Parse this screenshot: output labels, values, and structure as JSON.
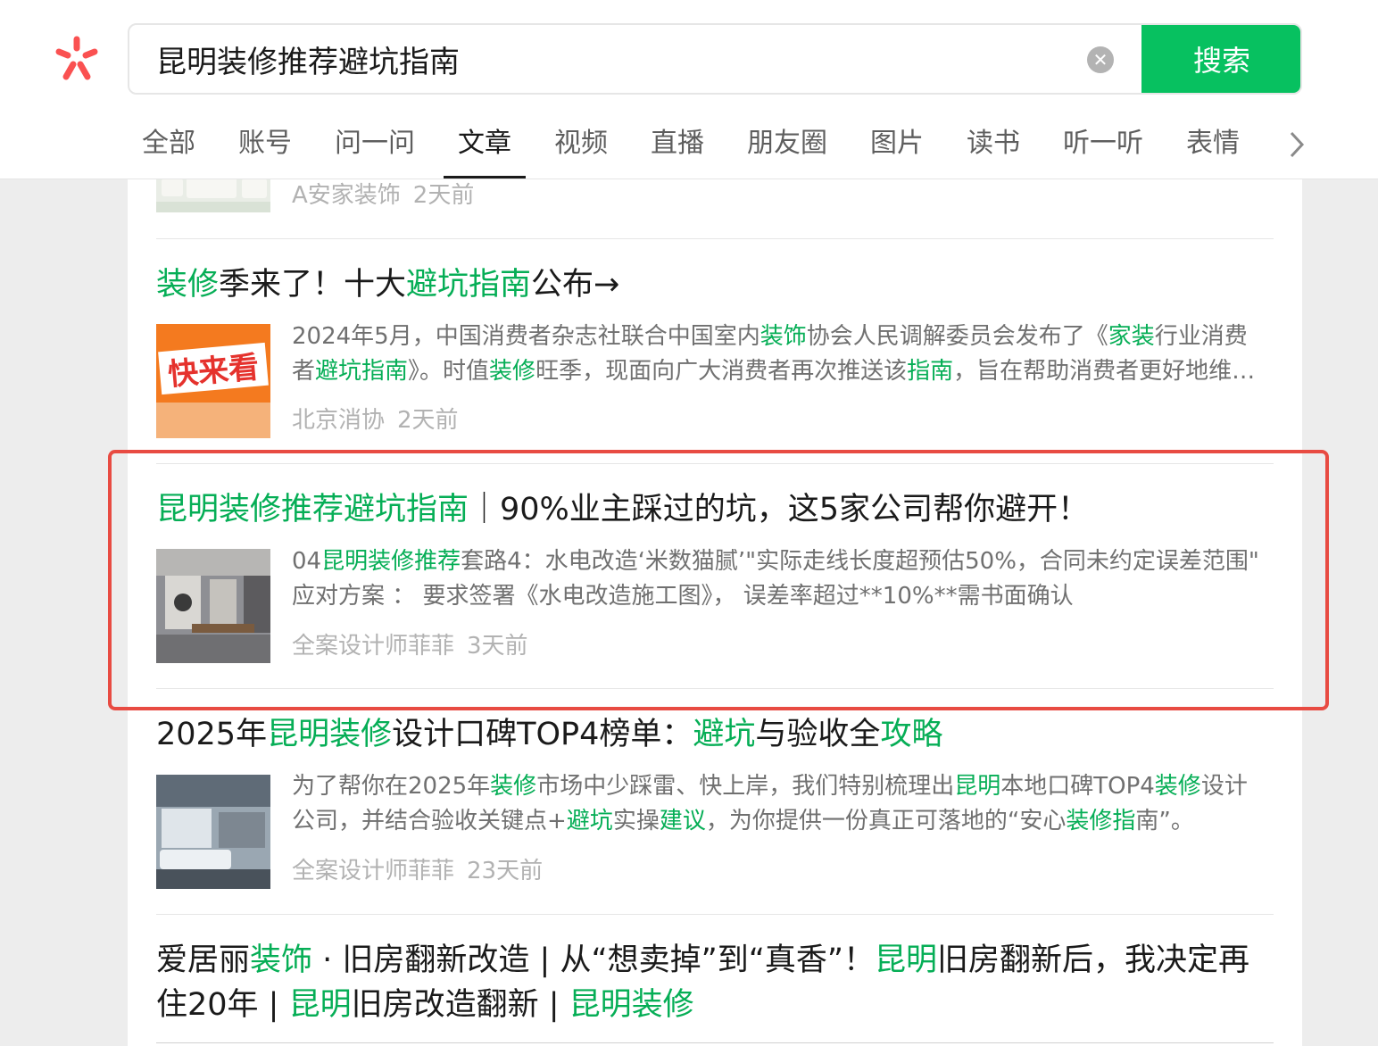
{
  "search": {
    "query": "昆明装修推荐避坑指南",
    "clear_icon": "close-circle-icon",
    "button_label": "搜索"
  },
  "tabs": [
    {
      "label": "全部",
      "active": false
    },
    {
      "label": "账号",
      "active": false
    },
    {
      "label": "问一问",
      "active": false
    },
    {
      "label": "文章",
      "active": true
    },
    {
      "label": "视频",
      "active": false
    },
    {
      "label": "直播",
      "active": false
    },
    {
      "label": "朋友圈",
      "active": false
    },
    {
      "label": "图片",
      "active": false
    },
    {
      "label": "读书",
      "active": false
    },
    {
      "label": "听一听",
      "active": false
    },
    {
      "label": "表情",
      "active": false
    }
  ],
  "results": [
    {
      "source": "A安家装饰",
      "time": "2天前"
    },
    {
      "title": [
        [
          "装修",
          true
        ],
        [
          "季来了！十大",
          false
        ],
        [
          "避坑指南",
          true
        ],
        [
          "公布→",
          false
        ]
      ],
      "desc": [
        [
          "2024年5月，中国消费者杂志社联合中国室内",
          false
        ],
        [
          "装饰",
          true
        ],
        [
          "协会人民调解委员会发布了《",
          false
        ],
        [
          "家装",
          true
        ],
        [
          "行业消费者",
          false
        ],
        [
          "避坑指南",
          true
        ],
        [
          "》。时值",
          false
        ],
        [
          "装修",
          true
        ],
        [
          "旺季，现面向广大消费者再次推送该",
          false
        ],
        [
          "指南",
          true
        ],
        [
          "，旨在帮助消费者更好地维护自身合法权益。",
          false
        ]
      ],
      "thumb_text": "快来看",
      "source": "北京消协",
      "time": "2天前"
    },
    {
      "title": [
        [
          "昆明装修推荐避坑指南",
          true
        ],
        [
          "｜90%业主踩过的坑，这5家公司帮你避开！",
          false
        ]
      ],
      "desc": [
        [
          "04",
          false
        ],
        [
          "昆明装修推荐",
          true
        ],
        [
          "套路4：水电改造‘米数猫腻’\"实际走线长度超预估50%，合同未约定误差范围\" 应对方案 ： 要求签署《水电改造施工图》， 误差率超过**10%**需书面确认",
          false
        ]
      ],
      "source": "全案设计师菲菲",
      "time": "3天前"
    },
    {
      "title": [
        [
          "2025年",
          false
        ],
        [
          "昆明装修",
          true
        ],
        [
          "设计口碑TOP4榜单：",
          false
        ],
        [
          "避坑",
          true
        ],
        [
          "与验收全",
          false
        ],
        [
          "攻略",
          true
        ]
      ],
      "desc": [
        [
          "为了帮你在2025年",
          false
        ],
        [
          "装修",
          true
        ],
        [
          "市场中少踩雷、快上岸，我们特别梳理出",
          false
        ],
        [
          "昆明",
          true
        ],
        [
          "本地口碑TOP4",
          false
        ],
        [
          "装修",
          true
        ],
        [
          "设计公司，并结合验收关键点+",
          false
        ],
        [
          "避坑",
          true
        ],
        [
          "实操",
          false
        ],
        [
          "建议",
          true
        ],
        [
          "，为你提供一份真正可落地的“安心",
          false
        ],
        [
          "装修指",
          true
        ],
        [
          "南”。",
          false
        ]
      ],
      "source": "全案设计师菲菲",
      "time": "23天前"
    },
    {
      "title": [
        [
          "爱居丽",
          false
        ],
        [
          "装饰",
          true
        ],
        [
          " · 旧房翻新改造 | 从“想卖掉”到“真香”！",
          false
        ],
        [
          "昆明",
          true
        ],
        [
          "旧房翻新后，我决定再住20年 | ",
          false
        ],
        [
          "昆明",
          true
        ],
        [
          "旧房改造翻新 | ",
          false
        ],
        [
          "昆明装修",
          true
        ]
      ]
    }
  ],
  "colors": {
    "accent": "#07c160",
    "highlight_text": "#06ae56",
    "annotation_border": "#e84b42"
  }
}
